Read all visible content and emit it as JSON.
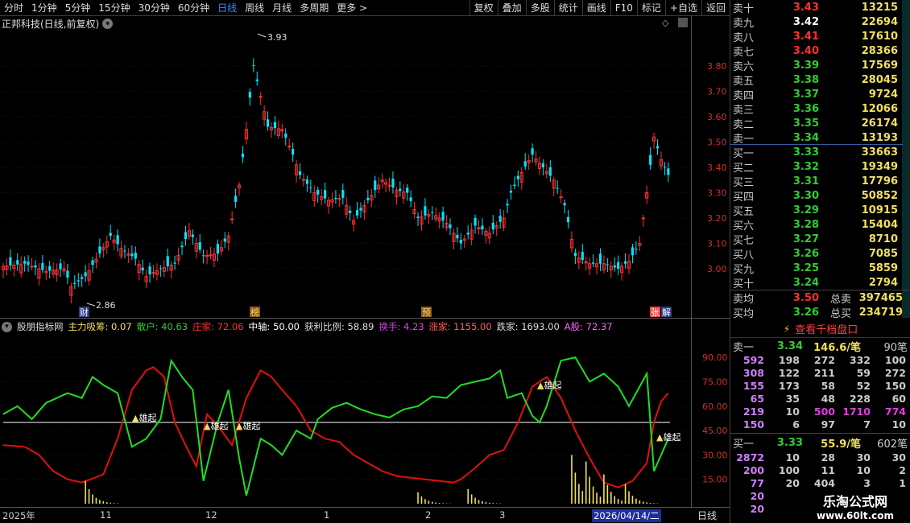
{
  "toolbar": {
    "left": [
      "分时",
      "1分钟",
      "5分钟",
      "15分钟",
      "30分钟",
      "60分钟",
      "日线",
      "周线",
      "月线",
      "多周期",
      "更多 >"
    ],
    "active": "日线",
    "right": [
      "复权",
      "叠加",
      "多股",
      "统计",
      "画线",
      "F10",
      "标记",
      "+自选",
      "返回"
    ]
  },
  "chart": {
    "title": "正邦科技(日线,前复权)",
    "high_label": "3.93",
    "low_label": "2.86",
    "price_ticks": [
      "3.80",
      "3.70",
      "3.60",
      "3.50",
      "3.40",
      "3.30",
      "3.20",
      "3.10",
      "3.00"
    ],
    "markers": [
      "财",
      "榜",
      "预",
      "张",
      "解"
    ]
  },
  "indicator": {
    "name": "股朋指标网",
    "fields": [
      {
        "label": "主力吸筹:",
        "value": "0.07",
        "color": "#f0e060"
      },
      {
        "label": "散户:",
        "value": "40.63",
        "color": "#3c3"
      },
      {
        "label": "庄家:",
        "value": "72.06",
        "color": "#ff3030"
      },
      {
        "label": "中轴:",
        "value": "50.00",
        "color": "#ffffff"
      },
      {
        "label": "获利比例:",
        "value": "58.89",
        "color": "#dddddd"
      },
      {
        "label": "换手:",
        "value": "4.23",
        "color": "#e040e0"
      },
      {
        "label": "涨家:",
        "value": "1155.00",
        "color": "#ff6060"
      },
      {
        "label": "跌家:",
        "value": "1693.00",
        "color": "#dddddd"
      },
      {
        "label": "A股:",
        "value": "72.37",
        "color": "#ff60ff"
      }
    ],
    "ticks": [
      "90.00",
      "75.00",
      "60.00",
      "45.00",
      "30.00",
      "15.00"
    ],
    "signal_label": "雄起"
  },
  "time_axis": {
    "labels": [
      "2025年",
      "11",
      "12",
      "1",
      "2",
      "3",
      "2026/04/14/二"
    ],
    "period": "日线"
  },
  "orderbook": {
    "asks": [
      {
        "label": "卖十",
        "price": "3.43",
        "vol": "13215"
      },
      {
        "label": "卖九",
        "price": "3.42",
        "vol": "22694"
      },
      {
        "label": "卖八",
        "price": "3.41",
        "vol": "17610"
      },
      {
        "label": "卖七",
        "price": "3.40",
        "vol": "28366"
      },
      {
        "label": "卖六",
        "price": "3.39",
        "vol": "17569"
      },
      {
        "label": "卖五",
        "price": "3.38",
        "vol": "28045"
      },
      {
        "label": "卖四",
        "price": "3.37",
        "vol": "9724"
      },
      {
        "label": "卖三",
        "price": "3.36",
        "vol": "12066"
      },
      {
        "label": "卖二",
        "price": "3.35",
        "vol": "26174"
      },
      {
        "label": "卖一",
        "price": "3.34",
        "vol": "13193"
      }
    ],
    "bids": [
      {
        "label": "买一",
        "price": "3.33",
        "vol": "33663"
      },
      {
        "label": "买二",
        "price": "3.32",
        "vol": "19349"
      },
      {
        "label": "买三",
        "price": "3.31",
        "vol": "17796"
      },
      {
        "label": "买四",
        "price": "3.30",
        "vol": "50852"
      },
      {
        "label": "买五",
        "price": "3.29",
        "vol": "10915"
      },
      {
        "label": "买六",
        "price": "3.28",
        "vol": "15404"
      },
      {
        "label": "买七",
        "price": "3.27",
        "vol": "8710"
      },
      {
        "label": "买八",
        "price": "3.26",
        "vol": "7085"
      },
      {
        "label": "买九",
        "price": "3.25",
        "vol": "5859"
      },
      {
        "label": "买十",
        "price": "3.24",
        "vol": "2794"
      }
    ],
    "sell_avg_label": "卖均",
    "sell_avg": "3.50",
    "sell_total_label": "总卖",
    "sell_total": "397465",
    "buy_avg_label": "买均",
    "buy_avg": "3.26",
    "buy_total_label": "总买",
    "buy_total": "234719"
  },
  "queue": {
    "title": "查看千档盘口",
    "ask_label": "卖一",
    "ask_price": "3.34",
    "ask_avg": "146.6/笔",
    "ask_count": "90笔",
    "ask_rows": [
      [
        "592",
        "198",
        "272",
        "332",
        "100"
      ],
      [
        "308",
        "122",
        "211",
        "59",
        "272"
      ],
      [
        "155",
        "173",
        "58",
        "52",
        "150"
      ],
      [
        "65",
        "35",
        "48",
        "228",
        "60"
      ],
      [
        "219",
        "10",
        "500",
        "1710",
        "774"
      ],
      [
        "150",
        "6",
        "97",
        "7",
        "10"
      ]
    ],
    "bid_label": "买一",
    "bid_price": "3.33",
    "bid_avg": "55.9/笔",
    "bid_count": "602笔",
    "bid_rows": [
      [
        "2872",
        "10",
        "28",
        "30",
        "30"
      ],
      [
        "200",
        "100",
        "11",
        "10",
        "2"
      ],
      [
        "77",
        "20",
        "404",
        "3",
        "1"
      ],
      [
        "20",
        "",
        "",
        "",
        ""
      ],
      [
        "20",
        "",
        "",
        "",
        ""
      ]
    ]
  },
  "watermark": {
    "line1": "乐淘公式网",
    "line2": "www.60lt.com"
  },
  "colors": {
    "up": "#ff3030",
    "down": "#00e5ff",
    "green": "#33cc33",
    "yellow": "#f0e060",
    "red_line": "#e01010",
    "green_line": "#22dd22"
  }
}
